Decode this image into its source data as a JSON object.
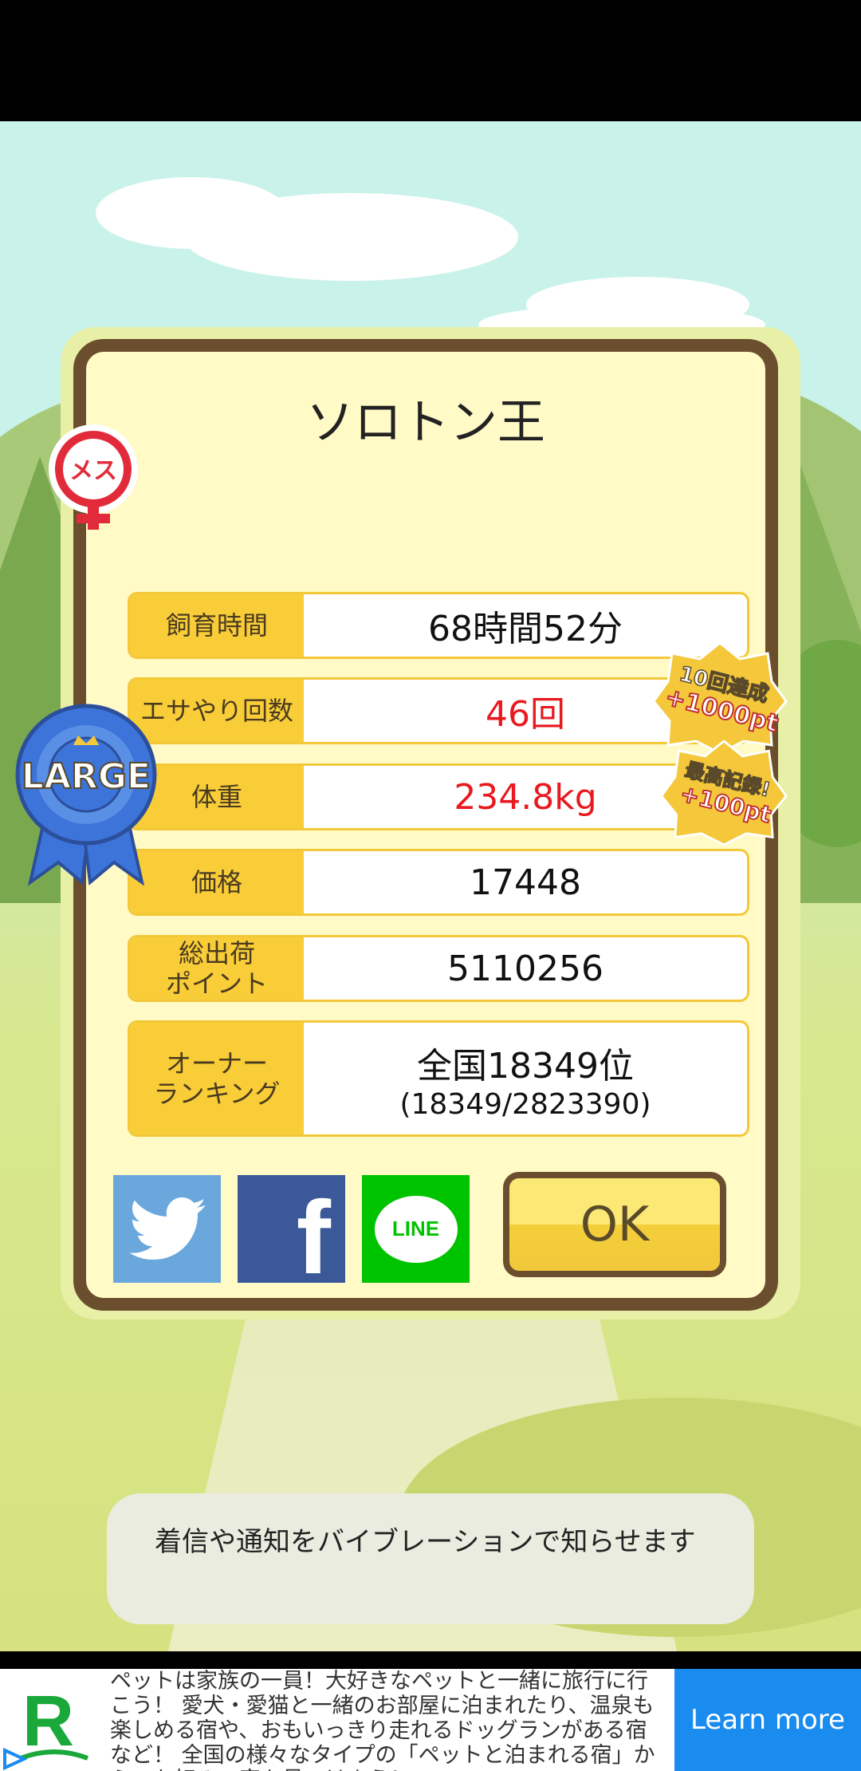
{
  "card": {
    "title": "ソロトン王",
    "rows": [
      {
        "label": "飼育時間",
        "value": "68時間52分"
      },
      {
        "label": "エサやり回数",
        "value": "46回"
      },
      {
        "label": "体重",
        "value": "234.8kg"
      },
      {
        "label": "価格",
        "value": "17448"
      },
      {
        "label": "総出荷\nポイント",
        "value": "5110256"
      },
      {
        "label": "オーナー\nランキング",
        "value": "全国18349位",
        "sub": "(18349/2823390)"
      }
    ],
    "gender_badge": "メス",
    "size_ribbon": "LARGE",
    "bonus_badges": [
      {
        "line1": "10回達成",
        "line2": "+1000pt"
      },
      {
        "line1": "最高記録!",
        "line2": "+100pt"
      }
    ],
    "share": {
      "twitter": "twitter-icon",
      "facebook": "f",
      "line": "LINE"
    },
    "ok_label": "OK"
  },
  "toast": "着信や通知をバイブレーションで知らせます",
  "ad": {
    "text": "ペットは家族の一員！大好きなペットと一緒に旅行に行こう！ 愛犬・愛猫と一緒のお部屋に泊まれたり、温泉も楽しめる宿や、おもいっきり走れるドッグランがある宿など！ 全国の様々なタイプの「ペットと泊まれる宿」から、お好みの宿を見つけよう！",
    "logo_letter": "R",
    "cta": "Learn more"
  },
  "colors": {
    "red_value": "#e8191f",
    "label_bg": "#f8cd38",
    "frame": "#6b4e2e",
    "cta_blue": "#1a8cf0"
  }
}
